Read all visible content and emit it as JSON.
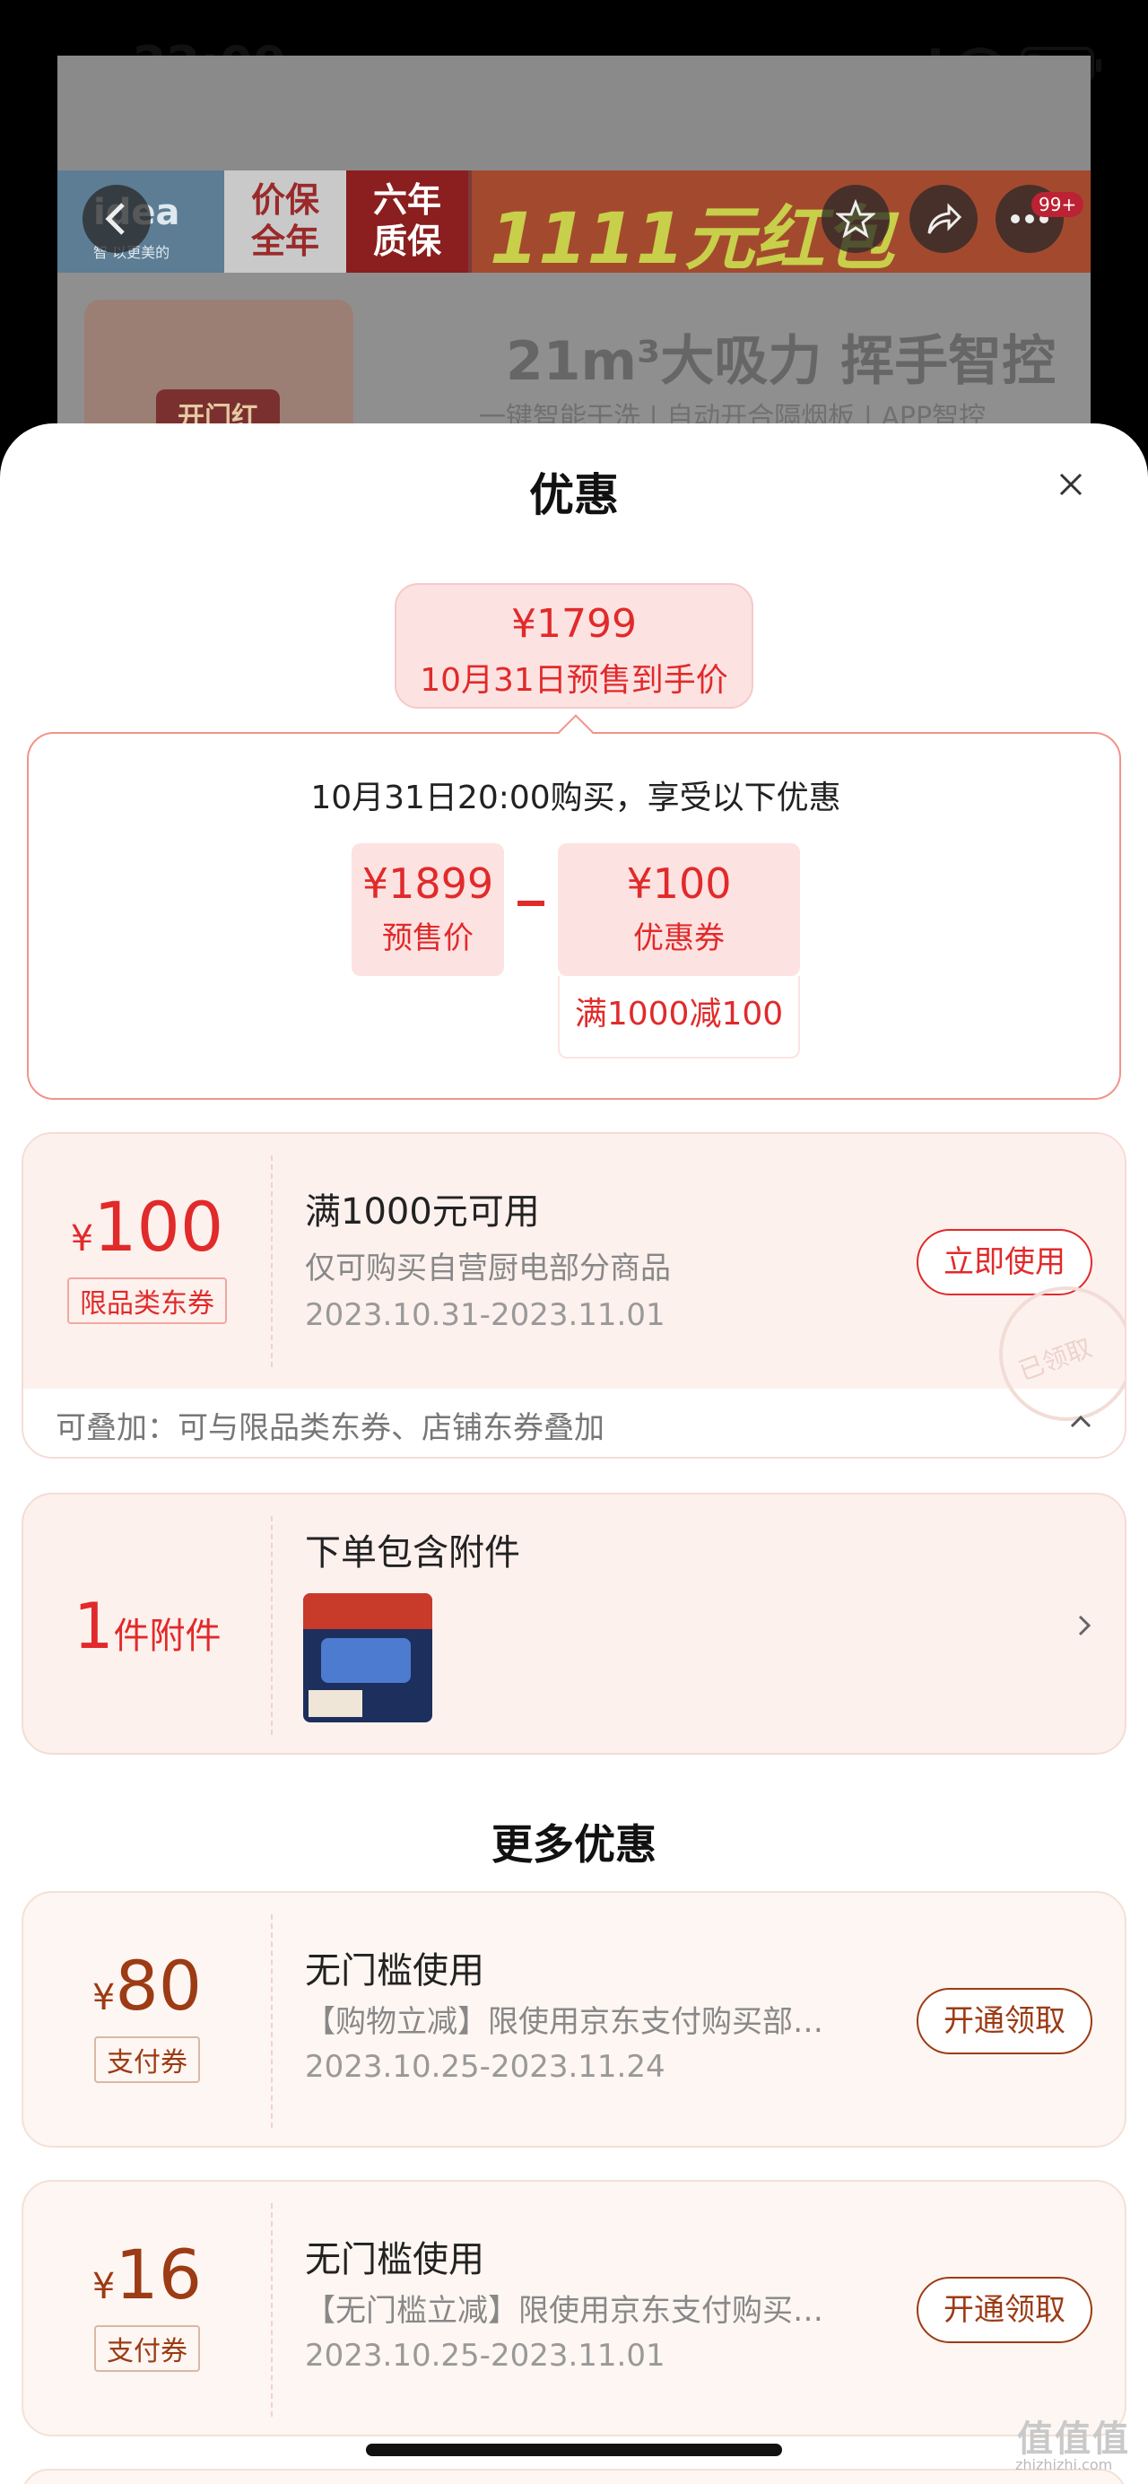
{
  "status_bar": {
    "time": "22:09"
  },
  "background_page": {
    "brand": "idea",
    "brand_sub": "智 以更美的",
    "tag_price": "价保\n全年",
    "tag_warranty": "六年\n质保",
    "promo": "1111元红包",
    "cart_badge": "99+",
    "badge_label": "开门红",
    "hero_title": "21m³大吸力 挥手智控",
    "hero_sub": "一键智能干洗 | 自动开合隔烟板 | APP智控"
  },
  "sheet": {
    "title": "优惠",
    "final_price": {
      "amount": "¥1799",
      "label": "10月31日预售到手价"
    },
    "breakdown": {
      "title": "10月31日20:00购买，享受以下优惠",
      "presale_amount": "¥1899",
      "presale_label": "预售价",
      "coupon_amount": "¥100",
      "coupon_label": "优惠券",
      "coupon_condition": "满1000减100"
    },
    "coupon_100": {
      "yen": "¥",
      "amount": "100",
      "tag": "限品类东券",
      "title": "满1000元可用",
      "desc": "仅可购买自营厨电部分商品",
      "date": "2023.10.31-2023.11.01",
      "button": "立即使用",
      "stack_info": "可叠加：可与限品类东券、店铺东券叠加",
      "stamp": "已领取"
    },
    "accessory": {
      "count": "1",
      "unit": "件附件",
      "title": "下单包含附件"
    },
    "more_title": "更多优惠",
    "pay_coupons": [
      {
        "yen": "¥",
        "amount": "80",
        "tag": "支付券",
        "title": "无门槛使用",
        "desc": "【购物立减】限使用京东支付购买部…",
        "date": "2023.10.25-2023.11.24",
        "button": "开通领取"
      },
      {
        "yen": "¥",
        "amount": "16",
        "tag": "支付券",
        "title": "无门槛使用",
        "desc": "【无门槛立减】限使用京东支付购买…",
        "date": "2023.10.25-2023.11.01",
        "button": "开通领取"
      }
    ]
  },
  "watermark": {
    "text": "值值值",
    "sub": "zhizhizhi.com"
  },
  "colors": {
    "accent_red": "#e12a2a",
    "pay_brown": "#9c3b14",
    "sheet_bg": "#ffffff"
  }
}
